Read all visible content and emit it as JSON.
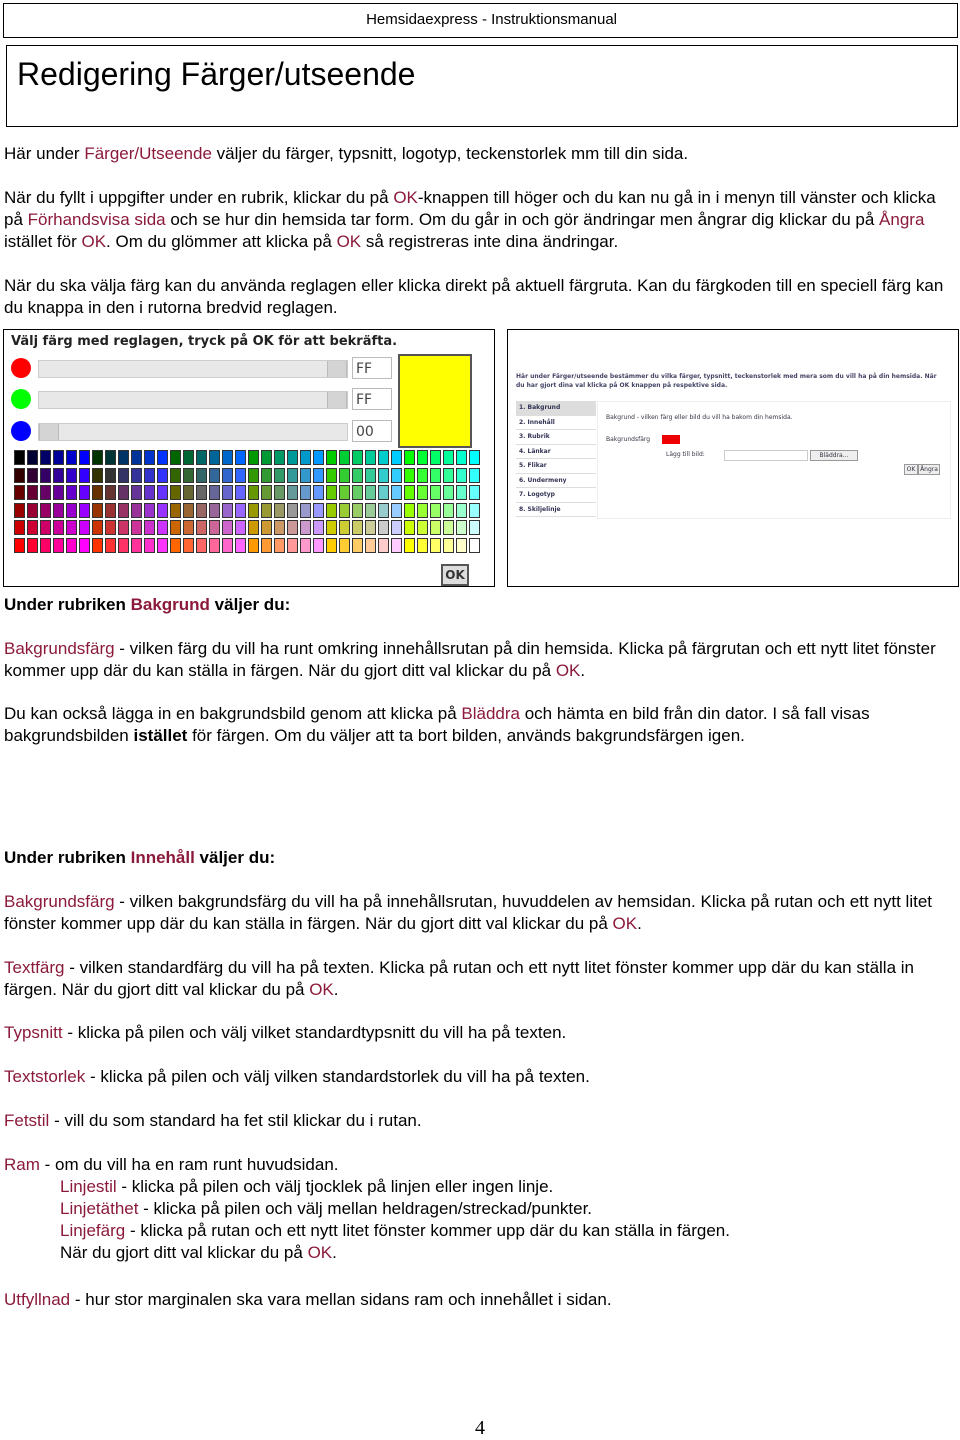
{
  "header": {
    "title": "Hemsidaexpress - Instruktionsmanual"
  },
  "page_title": "Redigering Färger/utseende",
  "accent_color": "#8b1a3a",
  "intro": {
    "a": "Här under ",
    "link": "Färger/Utseende",
    "b": " väljer du färger, typsnitt, logotyp, teckenstorlek mm till din sida."
  },
  "para2": {
    "a": "När du fyllt i uppgifter under en rubrik, klickar du på ",
    "ok1": "OK",
    "b": "-knappen till höger och du kan nu gå in i menyn till vänster och klicka på ",
    "preview": "Förhandsvisa sida",
    "c": " och se hur din hemsida tar form. Om du går in och gör ändringar men ångrar dig klickar du på ",
    "undo": "Ångra",
    "d": " istället för ",
    "ok2": "OK",
    "e": ". Om du glömmer att klicka på ",
    "ok3": "OK",
    "f": " så registreras inte dina ändringar."
  },
  "para3": "När du ska välja färg kan du använda reglagen eller klicka direkt på aktuell färgruta. Kan du färgkoden till en speciell färg kan du knappa in den i rutorna bredvid reglagen.",
  "color_picker": {
    "title": "Välj färg med reglagen, tryck på OK för att bekräfta.",
    "red": "FF",
    "green": "FF",
    "blue": "00",
    "red_level": 1.0,
    "green_level": 1.0,
    "blue_level": 0.0,
    "preview_color": "#ffff00",
    "ok": "OK"
  },
  "screenshot": {
    "intro": "Här under Färger/utseende bestämmer du vilka färger, typsnitt, teckenstorlek med mera som du vill ha på din hemsida. När du har gjort dina val klicka på OK knappen på respektive sida.",
    "menu": [
      "1. Bakgrund",
      "2. Innehåll",
      "3. Rubrik",
      "4. Länkar",
      "5. Flikar",
      "6. Undermeny",
      "7. Logotyp",
      "8. Skiljelinje"
    ],
    "panel_text": "Bakgrund - vilken färg eller bild du vill ha bakom din hemsida.",
    "bg_label": "Bakgrundsfärg",
    "add_image": "Lägg till bild:",
    "browse": "Bläddra...",
    "ok": "OK",
    "undo": "Ångra"
  },
  "bakgrund": {
    "heading_a": "Under rubriken ",
    "heading_link": "Bakgrund",
    "heading_b": " väljer du:",
    "p1": {
      "term": "Bakgrundsfärg",
      "a": " - vilken färg du vill ha runt omkring innehållsrutan på din hemsida. Klicka på färgrutan och ett nytt litet fönster kommer upp där du kan ställa in färgen. När du gjort ditt val klickar du på ",
      "ok": "OK",
      "b": "."
    },
    "p2": {
      "a": "Du kan också lägga in en bakgrundsbild genom att klicka på ",
      "link": "Bläddra",
      "b": " och hämta en bild från din dator. I så fall visas bakgrundsbilden ",
      "bold": "istället",
      "c": " för färgen. Om du väljer att ta bort bilden, används bakgrundsfärgen igen."
    }
  },
  "innehall": {
    "heading_a": "Under rubriken ",
    "heading_link": "Innehåll",
    "heading_b": " väljer du:",
    "p1": {
      "term": "Bakgrundsfärg",
      "a": " - vilken bakgrundsfärg du vill ha på innehållsrutan, huvuddelen av hemsidan. Klicka på rutan och ett nytt litet fönster kommer upp där du kan ställa in färgen. När du gjort ditt val klickar du på ",
      "ok": "OK",
      "b": "."
    },
    "p2": {
      "term": "Textfärg",
      "a": " - vilken standardfärg du vill ha på texten. Klicka på rutan och ett nytt litet fönster kommer upp där du kan ställa in färgen. När du gjort ditt val klickar du på ",
      "ok": "OK",
      "b": "."
    },
    "p3": {
      "term": "Typsnitt",
      "a": " - klicka på pilen och välj vilket standardtypsnitt du vill ha på texten."
    },
    "p4": {
      "term": "Textstorlek",
      "a": " - klicka på pilen och välj vilken standardstorlek du vill ha på texten."
    },
    "p5": {
      "term": "Fetstil",
      "a": " - vill du som standard ha fet stil klickar du i rutan."
    },
    "p6": {
      "term": "Ram",
      "a": " - om du vill ha en ram runt huvudsidan."
    },
    "p6a": {
      "term": "Linjestil",
      "a": " -  klicka på pilen och välj tjocklek på linjen eller ingen linje."
    },
    "p6b": {
      "term": "Linjetäthet",
      "a": " - klicka på pilen och välj mellan heldragen/streckad/punkter."
    },
    "p6c": {
      "term": "Linjefärg",
      "a": " - klicka på rutan och ett nytt litet fönster kommer upp där du kan ställa in färgen."
    },
    "p6d": {
      "a": "När du gjort ditt val klickar du på ",
      "ok": "OK",
      "b": "."
    },
    "p7": {
      "term": "Utfyllnad",
      "a": " - hur stor marginalen ska vara mellan sidans ram och innehållet i sidan."
    }
  },
  "page_number": "4"
}
